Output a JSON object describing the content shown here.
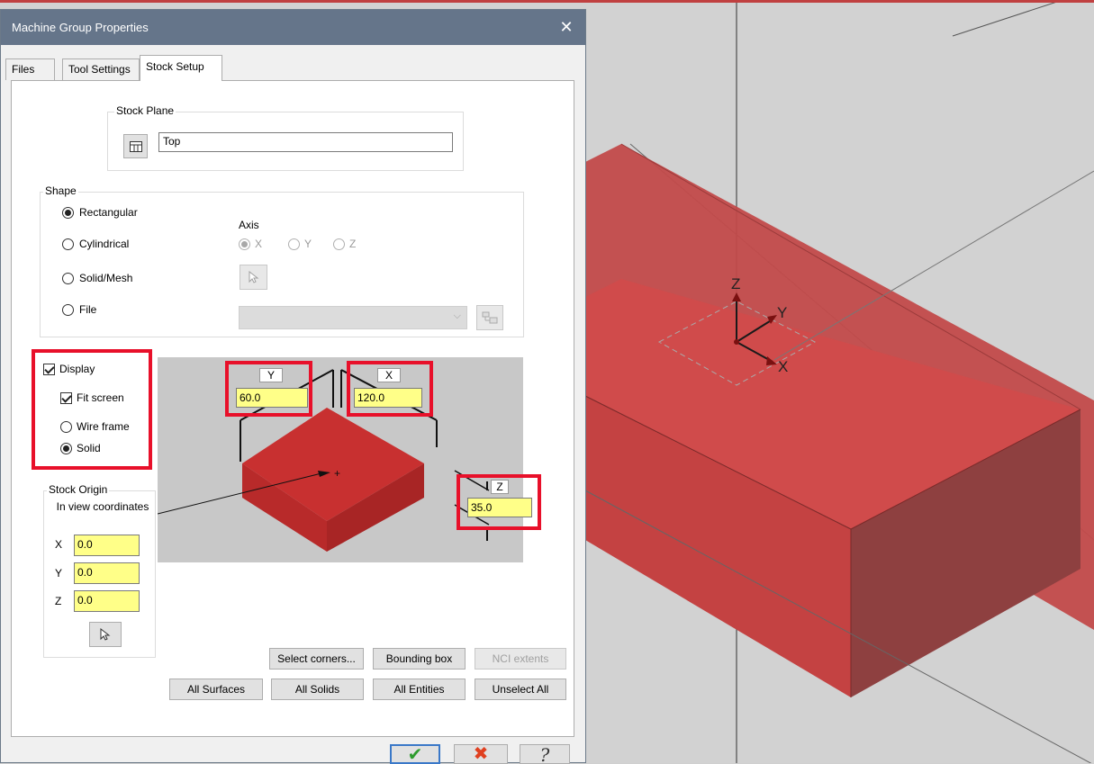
{
  "dialog": {
    "title": "Machine Group Properties",
    "close_glyph": "✕"
  },
  "tabs": [
    {
      "label": "Files"
    },
    {
      "label": "Tool Settings"
    },
    {
      "label": "Stock Setup"
    }
  ],
  "stock_plane": {
    "group_label": "Stock Plane",
    "value": "Top",
    "button_icon": "plane-table-icon"
  },
  "shape": {
    "group_label": "Shape",
    "options": [
      {
        "label": "Rectangular",
        "checked": true
      },
      {
        "label": "Cylindrical",
        "checked": false
      },
      {
        "label": "Solid/Mesh",
        "checked": false
      },
      {
        "label": "File",
        "checked": false
      }
    ],
    "axis": {
      "label": "Axis",
      "options": [
        {
          "label": "X",
          "checked": true
        },
        {
          "label": "Y",
          "checked": false
        },
        {
          "label": "Z",
          "checked": false
        }
      ]
    },
    "file_value": ""
  },
  "display": {
    "display_label": "Display",
    "display_checked": true,
    "fit_screen_label": "Fit screen",
    "fit_screen_checked": true,
    "wire_frame_label": "Wire frame",
    "solid_label": "Solid",
    "solid_checked": true
  },
  "dimensions": {
    "y_label": "Y",
    "y_value": "60.0",
    "x_label": "X",
    "x_value": "120.0",
    "z_label": "Z",
    "z_value": "35.0"
  },
  "stock_origin": {
    "group_label": "Stock Origin",
    "subtitle": "In view coordinates",
    "x_label": "X",
    "x_value": "0.0",
    "y_label": "Y",
    "y_value": "0.0",
    "z_label": "Z",
    "z_value": "0.0"
  },
  "buttons": {
    "select_corners": "Select corners...",
    "bounding_box": "Bounding box",
    "nci_extents": "NCI extents",
    "all_surfaces": "All Surfaces",
    "all_solids": "All Solids",
    "all_entities": "All Entities",
    "unselect_all": "Unselect All"
  },
  "footer": {
    "ok_glyph": "✔",
    "cancel_glyph": "✖",
    "help_glyph": "?"
  },
  "viewport": {
    "axis_labels": {
      "x": "X",
      "y": "Y",
      "z": "Z"
    }
  },
  "colors": {
    "stock_red": "#c94545",
    "title_bar": "#65758a",
    "highlight_red": "#e8102a",
    "field_yellow": "#ffff88"
  }
}
